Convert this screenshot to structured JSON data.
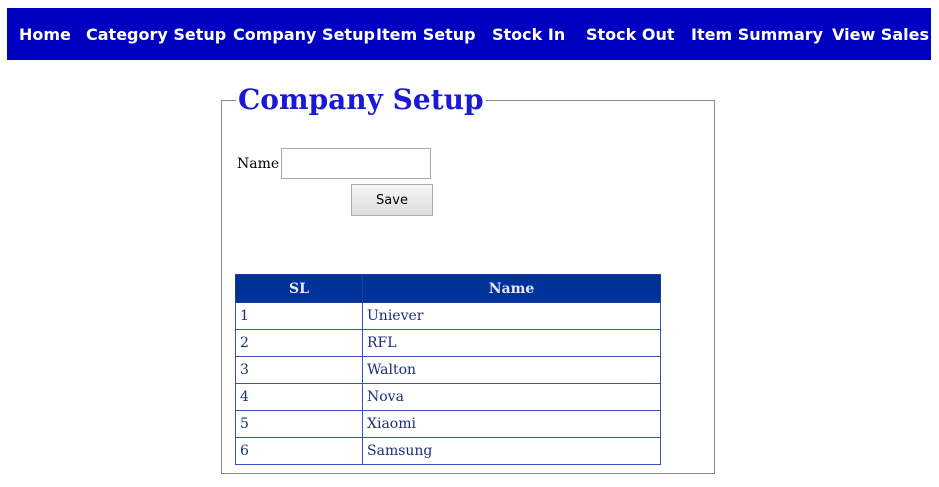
{
  "nav": {
    "items": [
      {
        "label": "Home"
      },
      {
        "label": "Category Setup"
      },
      {
        "label": "Company Setup"
      },
      {
        "label": "Item Setup"
      },
      {
        "label": "Stock In"
      },
      {
        "label": "Stock Out"
      },
      {
        "label": "Item Summary"
      },
      {
        "label": "View Sales"
      }
    ]
  },
  "form": {
    "legend": "Company Setup",
    "name_label": "Name",
    "name_value": "",
    "save_label": "Save"
  },
  "table": {
    "headers": [
      "SL",
      "Name"
    ],
    "rows": [
      [
        "1",
        "Uniever"
      ],
      [
        "2",
        "RFL"
      ],
      [
        "3",
        "Walton"
      ],
      [
        "4",
        "Nova"
      ],
      [
        "5",
        "Xiaomi"
      ],
      [
        "6",
        "Samsung"
      ]
    ]
  },
  "colors": {
    "nav_background": "#0000c0",
    "legend_text": "#1a1ad6",
    "table_header": "#003399"
  }
}
